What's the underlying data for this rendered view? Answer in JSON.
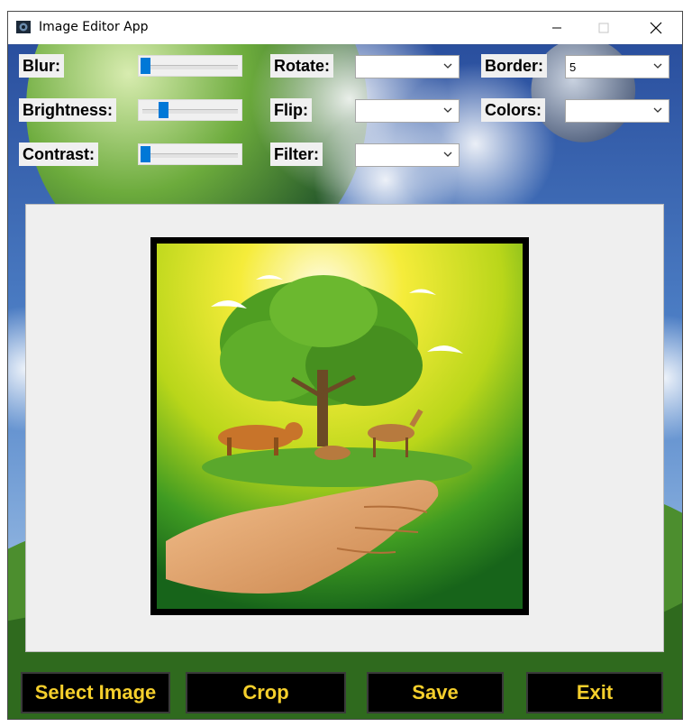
{
  "window": {
    "title": "Image Editor App"
  },
  "controls": {
    "blur_label": "Blur:",
    "brightness_label": "Brightness:",
    "contrast_label": "Contrast:",
    "rotate_label": "Rotate:",
    "flip_label": "Flip:",
    "filter_label": "Filter:",
    "border_label": "Border:",
    "colors_label": "Colors:",
    "border_value": "5",
    "rotate_value": "",
    "flip_value": "",
    "filter_value": "",
    "colors_value": "",
    "blur_level": 0.0,
    "brightness_level": 0.2,
    "contrast_level": 0.0
  },
  "buttons": {
    "select_image": "Select Image",
    "crop": "Crop",
    "save": "Save",
    "exit": "Exit"
  },
  "colors": {
    "accent": "#f5cf2c",
    "slider": "#0078d7"
  },
  "icons": [
    "app-icon",
    "minimize-icon",
    "maximize-icon",
    "close-icon",
    "chevron-down-icon"
  ]
}
